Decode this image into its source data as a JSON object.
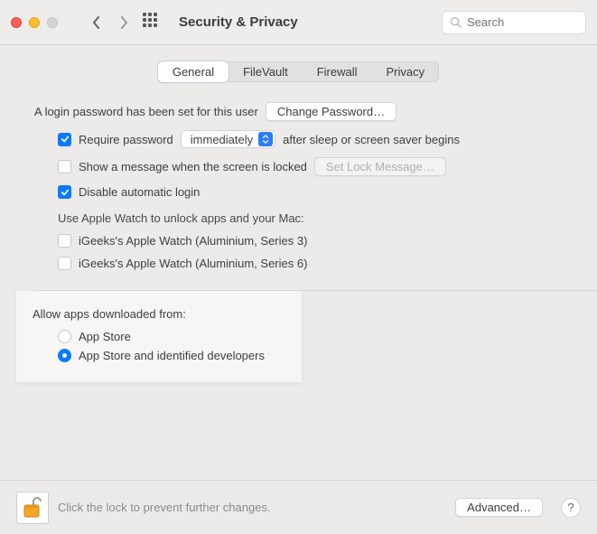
{
  "window": {
    "title": "Security & Privacy",
    "search_placeholder": "Search"
  },
  "tabs": [
    {
      "label": "General",
      "active": true
    },
    {
      "label": "FileVault",
      "active": false
    },
    {
      "label": "Firewall",
      "active": false
    },
    {
      "label": "Privacy",
      "active": false
    }
  ],
  "login": {
    "password_set_text": "A login password has been set for this user",
    "change_btn": "Change Password…",
    "require_pw_label": "Require password",
    "require_pw_delay": "immediately",
    "require_pw_suffix": "after sleep or screen saver begins",
    "show_message_label": "Show a message when the screen is locked",
    "set_lock_msg_btn": "Set Lock Message…",
    "disable_auto_login_label": "Disable automatic login",
    "require_pw_checked": true,
    "show_message_checked": false,
    "disable_auto_login_checked": true
  },
  "watch": {
    "heading": "Use Apple Watch to unlock apps and your Mac:",
    "devices": [
      {
        "label": "iGeeks's Apple Watch (Aluminium, Series 3)",
        "checked": false
      },
      {
        "label": "iGeeks's Apple Watch (Aluminium, Series 6)",
        "checked": false
      }
    ]
  },
  "allow": {
    "heading": "Allow apps downloaded from:",
    "options": [
      {
        "label": "App Store",
        "selected": false
      },
      {
        "label": "App Store and identified developers",
        "selected": true
      }
    ]
  },
  "footer": {
    "lock_text": "Click the lock to prevent further changes.",
    "advanced_btn": "Advanced…",
    "help": "?"
  }
}
